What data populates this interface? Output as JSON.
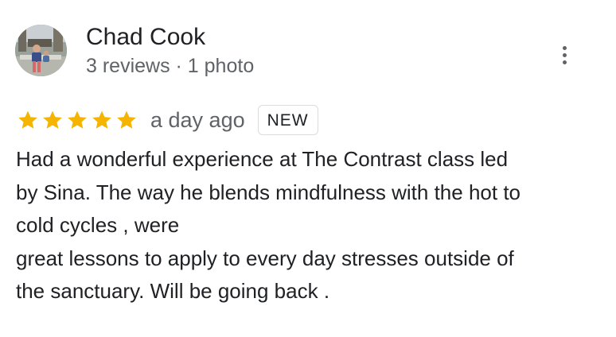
{
  "reviewer": {
    "name": "Chad Cook",
    "meta": "3 reviews · 1 photo",
    "avatar_icon": "user-photo-avatar"
  },
  "menu": {
    "icon": "more-vert-icon"
  },
  "rating": {
    "stars": 5,
    "max_stars": 5,
    "star_color": "#f4b400",
    "time": "a day ago",
    "badge": "NEW"
  },
  "review": {
    "lines": [
      "Had a wonderful experience at The Contrast class led",
      "by Sina. The way he blends mindfulness with the hot to",
      "cold cycles , were",
      "great lessons to apply to every day stresses outside of",
      "the sanctuary. Will be going back ."
    ]
  }
}
